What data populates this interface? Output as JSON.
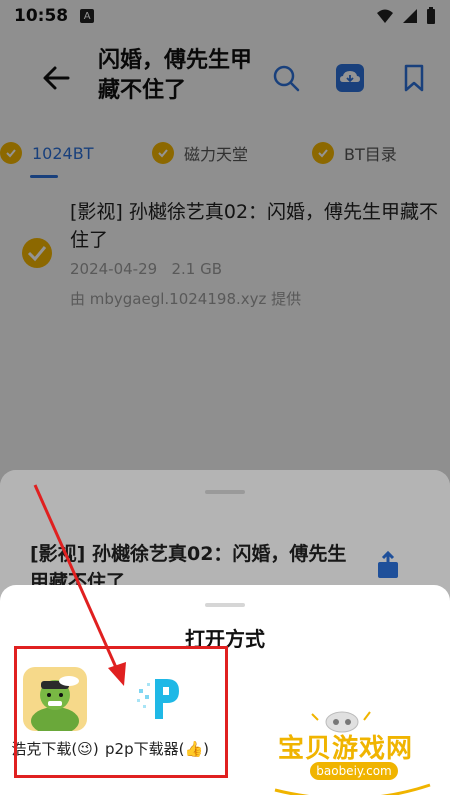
{
  "status": {
    "time": "10:58",
    "notif": "A"
  },
  "toolbar": {
    "title": "闪婚，傅先生甲藏不住了"
  },
  "tabs": [
    {
      "label": "1024BT",
      "active": true
    },
    {
      "label": "磁力天堂",
      "active": false
    },
    {
      "label": "BT目录",
      "active": false
    }
  ],
  "result": {
    "title": "[影视] 孙樾徐艺真02：闪婚，傅先生甲藏不住了",
    "date": "2024-04-29",
    "size": "2.1 GB",
    "source": "由 mbygaegl.1024198.xyz 提供"
  },
  "sheet1": {
    "title": "[影视] 孙樾徐艺真02：闪婚，傅先生甲藏不住了"
  },
  "sheet2": {
    "title": "打开方式",
    "apps": [
      {
        "label": "浩克下载(😉)",
        "icon": "hulk-icon"
      },
      {
        "label": "p2p下载器(👍)",
        "icon": "p2p-icon"
      }
    ]
  },
  "watermark": {
    "text": "宝贝游戏网",
    "url": "baobeiy.com"
  },
  "colors": {
    "accent": "#2b6fd6",
    "badge": "#f2b400",
    "highlight": "#e02020"
  }
}
